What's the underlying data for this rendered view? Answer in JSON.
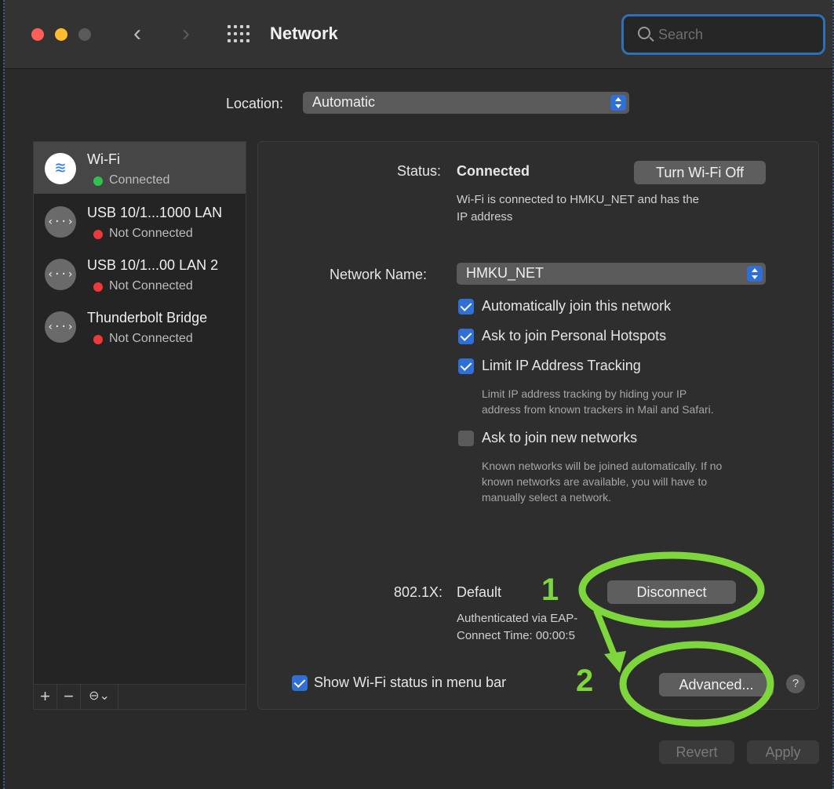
{
  "window": {
    "title": "Network",
    "search_placeholder": "Search"
  },
  "location": {
    "label": "Location:",
    "value": "Automatic"
  },
  "services": [
    {
      "name": "Wi-Fi",
      "status": "Connected",
      "status_color": "#2fc24f",
      "icon": "wifi-icon",
      "selected": true
    },
    {
      "name": "USB 10/1...1000 LAN",
      "status": "Not Connected",
      "status_color": "#ec3a3a",
      "icon": "ethernet-icon"
    },
    {
      "name": "USB 10/1...00 LAN 2",
      "status": "Not Connected",
      "status_color": "#ec3a3a",
      "icon": "ethernet-icon"
    },
    {
      "name": "Thunderbolt Bridge",
      "status": "Not Connected",
      "status_color": "#ec3a3a",
      "icon": "ethernet-icon"
    }
  ],
  "sidebar_toolbar": {
    "add": "+",
    "remove": "−",
    "more": "⊖⌄"
  },
  "detail": {
    "status_label": "Status:",
    "status_value": "Connected",
    "turn_off_button": "Turn Wi-Fi Off",
    "status_desc_line1": "Wi-Fi is connected to HMKU_NET and has the",
    "status_desc_line2": "IP address",
    "network_name_label": "Network Name:",
    "network_name_value": "HMKU_NET",
    "options": [
      {
        "label": "Automatically join this network",
        "checked": true
      },
      {
        "label": "Ask to join Personal Hotspots",
        "checked": true
      },
      {
        "label": "Limit IP Address Tracking",
        "checked": true
      },
      {
        "label": "Ask to join new networks",
        "checked": false
      }
    ],
    "limit_hint_line1": "Limit IP address tracking by hiding your IP",
    "limit_hint_line2": "address from known trackers in Mail and Safari.",
    "join_hint_line1": "Known networks will be joined automatically. If no",
    "join_hint_line2": "known networks are available, you will have to",
    "join_hint_line3": "manually select a network.",
    "dot1x_label": "802.1X:",
    "dot1x_value": "Default",
    "disconnect_button": "Disconnect",
    "auth_line": "Authenticated via EAP-",
    "connect_time": "Connect Time: 00:00:5",
    "show_status_label": "Show Wi-Fi status in menu bar",
    "advanced_button": "Advanced...",
    "help": "?"
  },
  "footer": {
    "revert": "Revert",
    "apply": "Apply"
  },
  "annotations": {
    "step1": "1",
    "step2": "2",
    "color": "#7ed63d"
  }
}
